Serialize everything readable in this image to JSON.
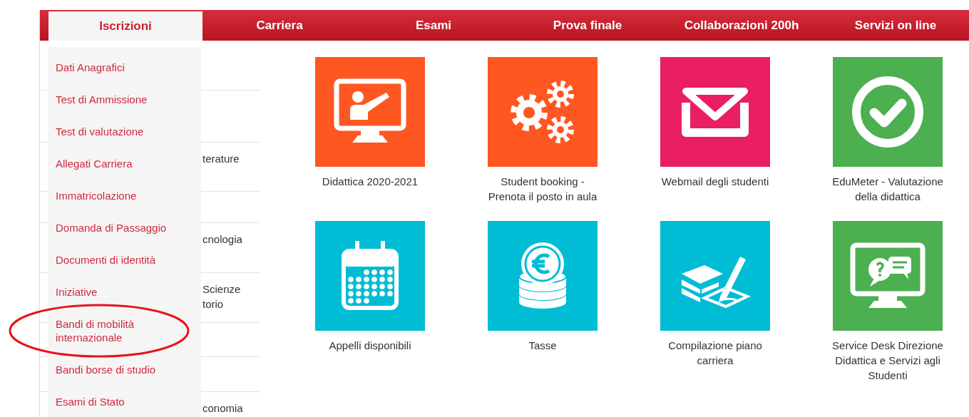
{
  "nav": {
    "tabs": [
      {
        "label": "Iscrizioni",
        "selected": true
      },
      {
        "label": "Carriera",
        "selected": false
      },
      {
        "label": "Esami",
        "selected": false
      },
      {
        "label": "Prova finale",
        "selected": false
      },
      {
        "label": "Collaborazioni 200h",
        "selected": false
      },
      {
        "label": "Servizi on line",
        "selected": false
      }
    ]
  },
  "dropdown": {
    "items": [
      {
        "label": "Dati Anagrafici",
        "highlighted": false
      },
      {
        "label": "Test di Ammissione",
        "highlighted": false
      },
      {
        "label": "Test di valutazione",
        "highlighted": false
      },
      {
        "label": "Allegati Carriera",
        "highlighted": false
      },
      {
        "label": "Immatricolazione",
        "highlighted": false
      },
      {
        "label": "Domanda di Passaggio",
        "highlighted": false
      },
      {
        "label": "Documenti di identità",
        "highlighted": false
      },
      {
        "label": "Iniziative",
        "highlighted": false
      },
      {
        "label": "Bandi di mobilità internazionale",
        "highlighted": true
      },
      {
        "label": "Bandi borse di studio",
        "highlighted": false
      },
      {
        "label": "Esami di Stato",
        "highlighted": false
      }
    ]
  },
  "side_list": {
    "rows": [
      {
        "lines": []
      },
      {
        "lines": []
      },
      {
        "lines": [
          "terature"
        ]
      },
      {
        "lines": []
      },
      {
        "lines": [
          "cnologia"
        ]
      },
      {
        "lines": [
          "Scienze",
          "torio"
        ]
      },
      {
        "lines": []
      },
      {
        "lines": []
      },
      {
        "lines": [
          "conomia"
        ]
      }
    ]
  },
  "tiles": [
    {
      "kind": "lesson",
      "color": "#fe5722",
      "label": "Didattica 2020-2021"
    },
    {
      "kind": "gears",
      "color": "#fe5722",
      "label": "Student booking - Prenota il posto in aula"
    },
    {
      "kind": "mail",
      "color": "#e91e63",
      "label": "Webmail degli studenti"
    },
    {
      "kind": "check",
      "color": "#4caf50",
      "label": "EduMeter - Valutazione della didattica"
    },
    {
      "kind": "calendar",
      "color": "#00bcd4",
      "label": "Appelli disponibili"
    },
    {
      "kind": "coins",
      "color": "#00bcd4",
      "label": "Tasse"
    },
    {
      "kind": "documents",
      "color": "#00bcd4",
      "label": "Compilazione piano carriera"
    },
    {
      "kind": "helpdesk",
      "color": "#4caf50",
      "label": "Service Desk Direzione Didattica e Servizi agli Studenti"
    }
  ]
}
